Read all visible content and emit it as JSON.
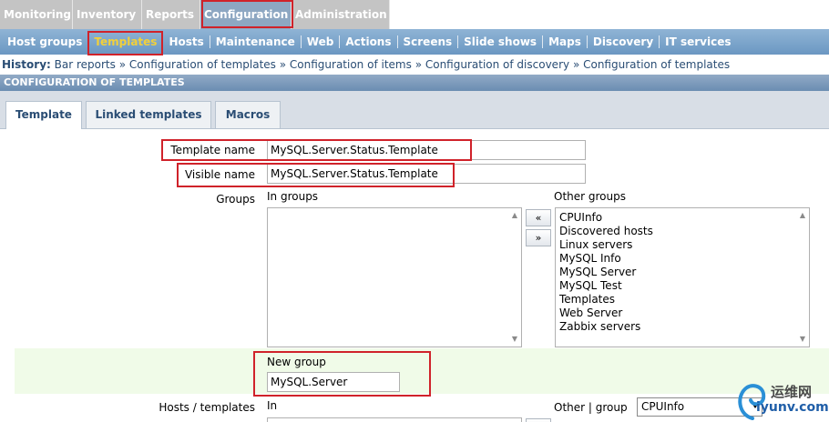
{
  "topmenu": {
    "tabs": [
      {
        "label": "Monitoring"
      },
      {
        "label": "Inventory"
      },
      {
        "label": "Reports"
      },
      {
        "label": "Configuration",
        "active": true
      },
      {
        "label": "Administration"
      }
    ]
  },
  "submenu": {
    "items": [
      "Host groups",
      "Templates",
      "Hosts",
      "Maintenance",
      "Web",
      "Actions",
      "Screens",
      "Slide shows",
      "Maps",
      "Discovery",
      "IT services"
    ],
    "active": "Templates"
  },
  "history": {
    "label": "History:",
    "items": [
      "Bar reports",
      "Configuration of templates",
      "Configuration of items",
      "Configuration of discovery",
      "Configuration of templates"
    ],
    "separator": "»"
  },
  "header": {
    "title": "CONFIGURATION OF TEMPLATES"
  },
  "tabs": [
    {
      "label": "Template",
      "active": true
    },
    {
      "label": "Linked templates"
    },
    {
      "label": "Macros"
    }
  ],
  "form": {
    "template_name_label": "Template name",
    "template_name_value": "MySQL.Server.Status.Template",
    "visible_name_label": "Visible name",
    "visible_name_value": "MySQL.Server.Status.Template",
    "groups_label": "Groups",
    "in_groups_label": "In groups",
    "other_groups_label": "Other groups",
    "add_button": "«",
    "remove_button": "»",
    "other_groups": [
      "CPUInfo",
      "Discovered hosts",
      "Linux servers",
      "MySQL Info",
      "MySQL Server",
      "MySQL Test",
      "Templates",
      "Web Server",
      "Zabbix servers"
    ],
    "new_group_label": "New group",
    "new_group_value": "MySQL.Server",
    "hosts_templates_label": "Hosts / templates",
    "in_label": "In",
    "other_group_label": "Other | group",
    "group_select_value": "CPUInfo"
  },
  "watermark": {
    "line1": "运维网",
    "line2": "iyunv.com"
  },
  "colors": {
    "highlight_border": "#d0222a",
    "active_submenu": "#f2d03a",
    "new_group_bg": "#f0fbe8"
  }
}
